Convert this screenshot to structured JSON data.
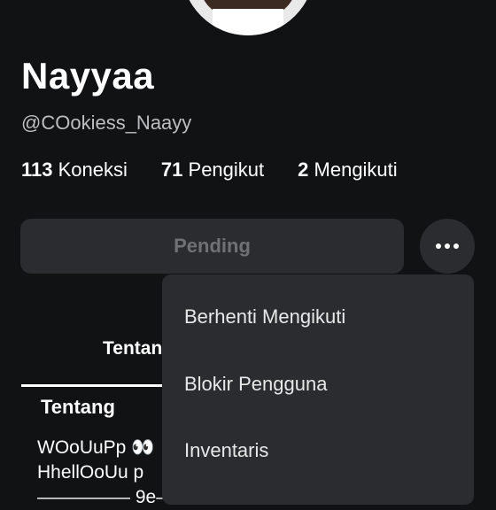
{
  "profile": {
    "display_name": "Nayyaa",
    "username": "@COokiess_Naayy",
    "stats": [
      {
        "count": "113",
        "label": "Koneksi"
      },
      {
        "count": "71",
        "label": "Pengikut"
      },
      {
        "count": "2",
        "label": "Mengikuti"
      }
    ]
  },
  "actions": {
    "pending_label": "Pending",
    "more_icon": "ellipsis-icon"
  },
  "tabs": {
    "about_tab": "Tentang"
  },
  "about": {
    "title": "Tentang",
    "line1": "WOoUuPp 👀",
    "line2": "HhellOoUu p",
    "line3": "————— 9e—————"
  },
  "menu": {
    "items": [
      "Berhenti Mengikuti",
      "Blokir Pengguna",
      "Inventaris"
    ]
  },
  "colors": {
    "background": "#111214",
    "surface": "#2b2c30",
    "muted_text": "#bdbec0"
  }
}
